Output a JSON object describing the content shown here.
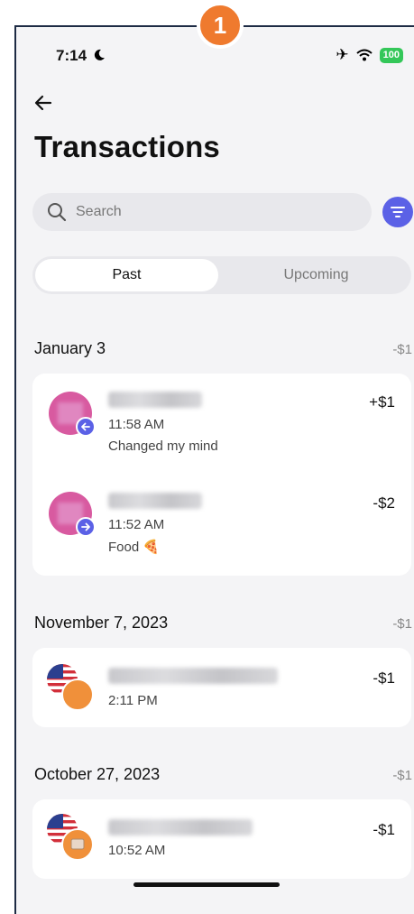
{
  "step_badge": "1",
  "status_bar": {
    "time": "7:14",
    "battery": "100",
    "icons": [
      "moon-icon",
      "airplane-icon",
      "wifi-icon",
      "battery-icon"
    ]
  },
  "header": {
    "back_icon": "arrow-left-icon",
    "title": "Transactions"
  },
  "search": {
    "placeholder": "Search",
    "filter_icon": "filter-icon"
  },
  "tabs": [
    {
      "label": "Past",
      "selected": true
    },
    {
      "label": "Upcoming",
      "selected": false
    }
  ],
  "sections": [
    {
      "date": "January 3",
      "total": "-$1",
      "transactions": [
        {
          "time": "11:58 AM",
          "note": "Changed my mind",
          "amount": "+$1",
          "direction": "incoming"
        },
        {
          "time": "11:52 AM",
          "note": "Food 🍕",
          "amount": "-$2",
          "direction": "outgoing"
        }
      ]
    },
    {
      "date": "November 7, 2023",
      "total": "-$1",
      "transactions": [
        {
          "time": "2:11 PM",
          "amount": "-$1"
        }
      ]
    },
    {
      "date": "October 27, 2023",
      "total": "-$1",
      "transactions": [
        {
          "time": "10:52 AM",
          "amount": "-$1"
        }
      ]
    }
  ],
  "colors": {
    "accent": "#5b61e6",
    "avatar_pink": "#d85aa0",
    "badge_orange": "#ef7a2e",
    "battery_green": "#34c759"
  }
}
